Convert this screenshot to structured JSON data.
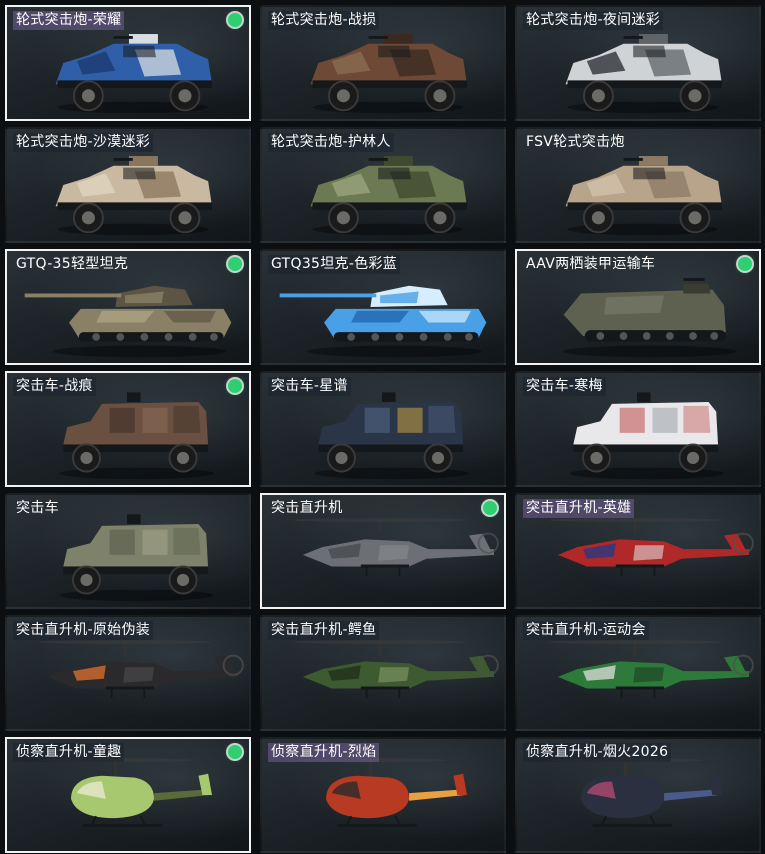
{
  "colors": {
    "selected_border": "#f2f2f2",
    "status_dot": "#2ecf71",
    "label_highlight": "#735f96"
  },
  "vehicles": [
    {
      "name": "轮式突击炮-荣耀",
      "type": "wheeled",
      "camo": [
        "#2f5fa8",
        "#d8dde3",
        "#1d3a70"
      ],
      "selected": true,
      "status": true,
      "highlight": "purple"
    },
    {
      "name": "轮式突击炮-战损",
      "type": "wheeled",
      "camo": [
        "#6e4a36",
        "#3a2a22",
        "#8b6a52"
      ],
      "selected": false,
      "status": false,
      "highlight": "dark"
    },
    {
      "name": "轮式突击炮-夜间迷彩",
      "type": "wheeled",
      "camo": [
        "#cfd3d6",
        "#5f6468",
        "#2e3236"
      ],
      "selected": false,
      "status": false,
      "highlight": "dark"
    },
    {
      "name": "轮式突击炮-沙漠迷彩",
      "type": "wheeled",
      "camo": [
        "#c9b9a0",
        "#8a765c",
        "#e0d4c0"
      ],
      "selected": false,
      "status": false,
      "highlight": "dark"
    },
    {
      "name": "轮式突击炮-护林人",
      "type": "wheeled",
      "camo": [
        "#6b7a52",
        "#3f4a30",
        "#9aa47c"
      ],
      "selected": false,
      "status": false,
      "highlight": "dark"
    },
    {
      "name": "FSV轮式突击炮",
      "type": "wheeled",
      "camo": [
        "#b8a48a",
        "#8c7a64",
        "#d2c2aa"
      ],
      "selected": false,
      "status": false,
      "highlight": "none"
    },
    {
      "name": "GTQ-35轻型坦克",
      "type": "tank",
      "camo": [
        "#8a8066",
        "#5c5544",
        "#b0a688"
      ],
      "selected": true,
      "status": true,
      "highlight": "none"
    },
    {
      "name": "GTQ35坦克-色彩蓝",
      "type": "tank",
      "camo": [
        "#4aa0e6",
        "#d6ecff",
        "#1c5fa8"
      ],
      "selected": false,
      "status": false,
      "highlight": "dark"
    },
    {
      "name": "AAV两栖装甲运输车",
      "type": "amphibious",
      "camo": [
        "#5e6050",
        "#3a3c32",
        "#7c7e6a"
      ],
      "selected": true,
      "status": true,
      "highlight": "none"
    },
    {
      "name": "突击车-战痕",
      "type": "mrap",
      "camo": [
        "#6a5040",
        "#3a2c24",
        "#8c6c58"
      ],
      "selected": true,
      "status": true,
      "highlight": "dark"
    },
    {
      "name": "突击车-星谱",
      "type": "mrap",
      "camo": [
        "#2a3548",
        "#56688a",
        "#c8a040"
      ],
      "selected": false,
      "status": false,
      "highlight": "dark"
    },
    {
      "name": "突击车-寒梅",
      "type": "mrap",
      "camo": [
        "#e8e8ea",
        "#c04848",
        "#9aa0a6"
      ],
      "selected": false,
      "status": false,
      "highlight": "dark"
    },
    {
      "name": "突击车",
      "type": "mrap",
      "camo": [
        "#7e826a",
        "#565a48",
        "#a4a88c"
      ],
      "selected": false,
      "status": false,
      "highlight": "none"
    },
    {
      "name": "突击直升机",
      "type": "heli",
      "camo": [
        "#6c7074",
        "#45494d",
        "#8c9094"
      ],
      "selected": true,
      "status": true,
      "highlight": "none"
    },
    {
      "name": "突击直升机-英雄",
      "type": "heli",
      "camo": [
        "#b02828",
        "#203a8a",
        "#e8e8e8"
      ],
      "selected": false,
      "status": false,
      "highlight": "purple"
    },
    {
      "name": "突击直升机-原始伪装",
      "type": "heli",
      "camo": [
        "#2a2a2c",
        "#e07030",
        "#505055"
      ],
      "selected": false,
      "status": false,
      "highlight": "dark"
    },
    {
      "name": "突击直升机-鳄鱼",
      "type": "heli",
      "camo": [
        "#3e5a30",
        "#1f2e18",
        "#8aa070"
      ],
      "selected": false,
      "status": false,
      "highlight": "dark"
    },
    {
      "name": "突击直升机-运动会",
      "type": "heli",
      "camo": [
        "#2e7a3a",
        "#e0e0e0",
        "#1a3a20"
      ],
      "selected": false,
      "status": false,
      "highlight": "dark"
    },
    {
      "name": "侦察直升机-童趣",
      "type": "scout",
      "camo": [
        "#a8c870",
        "#e8e8d0",
        "#5a6a38"
      ],
      "selected": true,
      "status": true,
      "highlight": "dark"
    },
    {
      "name": "侦察直升机-烈焰",
      "type": "scout",
      "camo": [
        "#b83a22",
        "#2a2a2a",
        "#e8a040"
      ],
      "selected": false,
      "status": false,
      "highlight": "purple"
    },
    {
      "name": "侦察直升机-烟火2026",
      "type": "scout",
      "camo": [
        "#2a3040",
        "#b04a70",
        "#4a5a8a"
      ],
      "selected": false,
      "status": false,
      "highlight": "dark"
    }
  ]
}
